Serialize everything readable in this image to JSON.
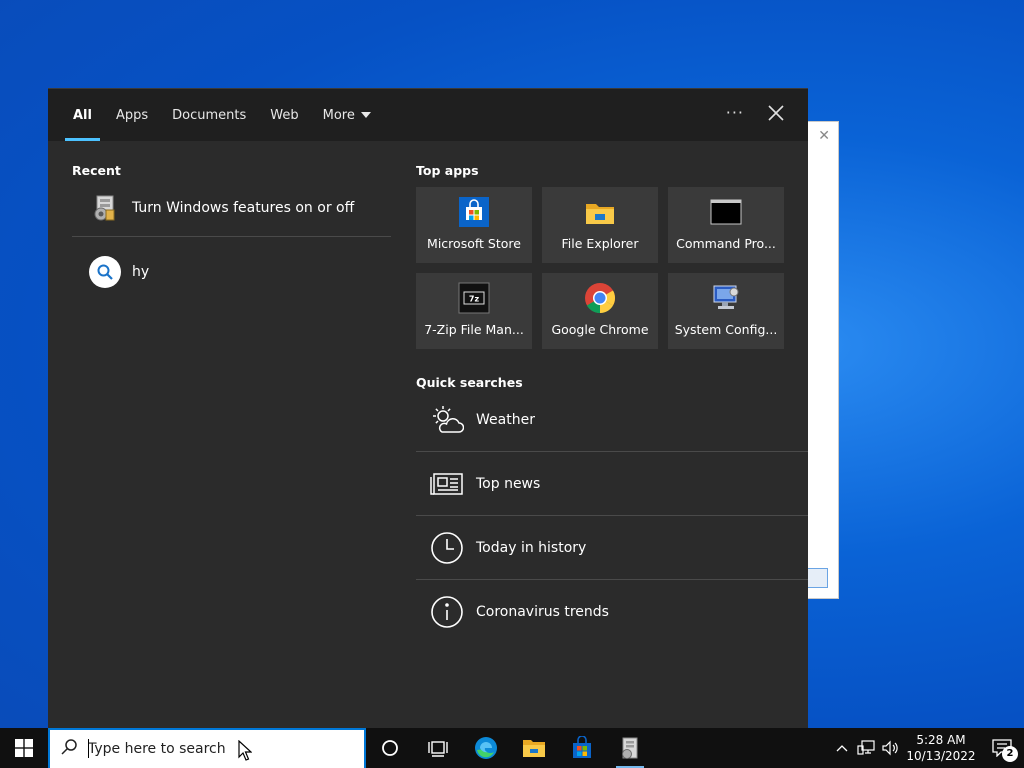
{
  "tabs": [
    {
      "label": "All",
      "active": true
    },
    {
      "label": "Apps"
    },
    {
      "label": "Documents"
    },
    {
      "label": "Web"
    },
    {
      "label": "More"
    }
  ],
  "topbar": {
    "more_options_icon": "ellipsis-icon",
    "close_icon": "close-icon"
  },
  "recent": {
    "title": "Recent",
    "items": [
      {
        "label": "Turn Windows features on or off",
        "icon": "windows-features-icon"
      },
      {
        "label": "hy",
        "icon": "search-icon"
      }
    ]
  },
  "top_apps": {
    "title": "Top apps",
    "items": [
      {
        "label": "Microsoft Store",
        "icon": "microsoft-store-icon"
      },
      {
        "label": "File Explorer",
        "icon": "file-explorer-icon"
      },
      {
        "label": "Command Pro...",
        "icon": "command-prompt-icon"
      },
      {
        "label": "7-Zip File Man...",
        "icon": "7zip-icon"
      },
      {
        "label": "Google Chrome",
        "icon": "chrome-icon"
      },
      {
        "label": "System Config...",
        "icon": "system-config-icon"
      }
    ]
  },
  "quick_searches": {
    "title": "Quick searches",
    "items": [
      {
        "label": "Weather",
        "icon": "weather-icon"
      },
      {
        "label": "Top news",
        "icon": "news-icon"
      },
      {
        "label": "Today in history",
        "icon": "clock-icon"
      },
      {
        "label": "Coronavirus trends",
        "icon": "info-icon"
      }
    ]
  },
  "taskbar": {
    "search_placeholder": "Type here to search",
    "clock_time": "5:28 AM",
    "clock_date": "10/13/2022",
    "notification_count": "2"
  },
  "colors": {
    "accent": "#4cc2ff",
    "panel": "#2b2b2b",
    "tile": "#3a3a3a",
    "taskbar": "#101010"
  }
}
